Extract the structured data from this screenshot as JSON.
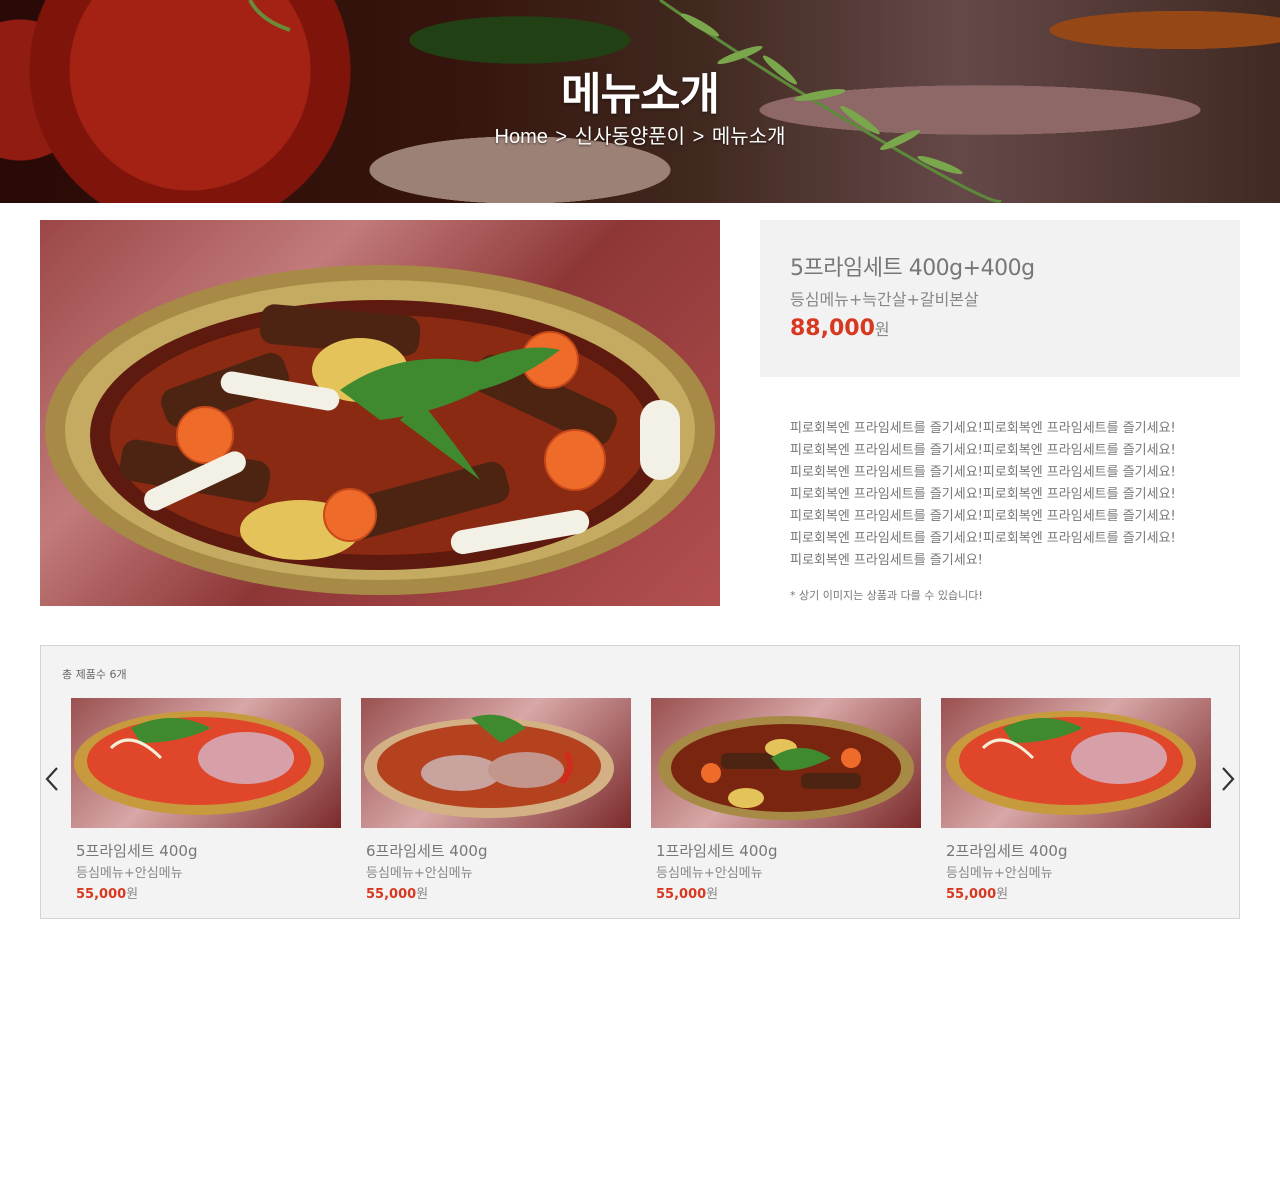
{
  "hero": {
    "title": "메뉴소개",
    "breadcrumb": [
      "Home",
      ">",
      "신사동양푼이",
      ">",
      "메뉴소개"
    ]
  },
  "product": {
    "name": "5프라임세트 400g+400g",
    "subtitle": "등심메뉴+늑간살+갈비본살",
    "price": "88,000",
    "currency": "원",
    "description_lines": [
      "피로회복엔 프라임세트를 즐기세요!피로회복엔 프라임세트를 즐기세요!",
      "피로회복엔 프라임세트를 즐기세요!피로회복엔 프라임세트를 즐기세요!",
      "피로회복엔 프라임세트를 즐기세요!피로회복엔 프라임세트를 즐기세요!",
      "피로회복엔 프라임세트를 즐기세요!피로회복엔 프라임세트를 즐기세요!",
      "피로회복엔 프라임세트를 즐기세요!피로회복엔 프라임세트를 즐기세요!",
      "피로회복엔 프라임세트를 즐기세요!피로회복엔 프라임세트를 즐기세요!",
      "피로회복엔 프라임세트를 즐기세요!"
    ],
    "note": "* 상기 이미지는 상품과 다를 수 있습니다!"
  },
  "carousel": {
    "count_label": "총 제품수 6개",
    "prev_icon": "chevron-left-icon",
    "next_icon": "chevron-right-icon",
    "items": [
      {
        "name": "5프라임세트 400g",
        "subtitle": "등심메뉴+안심메뉴",
        "price": "55,000",
        "currency": "원"
      },
      {
        "name": "6프라임세트 400g",
        "subtitle": "등심메뉴+안심메뉴",
        "price": "55,000",
        "currency": "원"
      },
      {
        "name": "1프라임세트 400g",
        "subtitle": "등심메뉴+안심메뉴",
        "price": "55,000",
        "currency": "원"
      },
      {
        "name": "2프라임세트 400g",
        "subtitle": "등심메뉴+안심메뉴",
        "price": "55,000",
        "currency": "원"
      }
    ]
  },
  "colors": {
    "price": "#d7381f",
    "panel_bg": "#f2f2f2",
    "border": "#d4d4d4"
  }
}
